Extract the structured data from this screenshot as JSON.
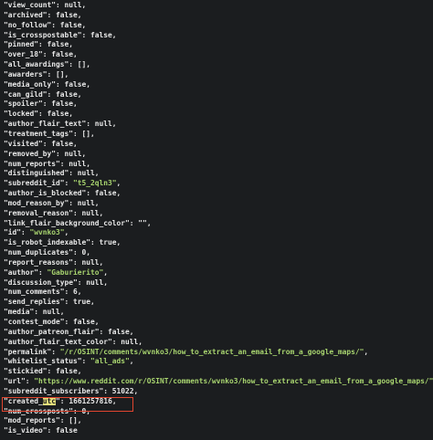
{
  "lines": [
    {
      "key": "\"view_count\"",
      "sep": ": ",
      "val": "null",
      "str": false,
      "end": ","
    },
    {
      "key": "\"archived\"",
      "sep": ": ",
      "val": "false",
      "str": false,
      "end": ","
    },
    {
      "key": "\"no_follow\"",
      "sep": ": ",
      "val": "false",
      "str": false,
      "end": ","
    },
    {
      "key": "\"is_crosspostable\"",
      "sep": ": ",
      "val": "false",
      "str": false,
      "end": ","
    },
    {
      "key": "\"pinned\"",
      "sep": ": ",
      "val": "false",
      "str": false,
      "end": ","
    },
    {
      "key": "\"over_18\"",
      "sep": ": ",
      "val": "false",
      "str": false,
      "end": ","
    },
    {
      "key": "\"all_awardings\"",
      "sep": ": ",
      "val": "[]",
      "str": false,
      "end": ","
    },
    {
      "key": "\"awarders\"",
      "sep": ": ",
      "val": "[]",
      "str": false,
      "end": ","
    },
    {
      "key": "\"media_only\"",
      "sep": ": ",
      "val": "false",
      "str": false,
      "end": ","
    },
    {
      "key": "\"can_gild\"",
      "sep": ": ",
      "val": "false",
      "str": false,
      "end": ","
    },
    {
      "key": "\"spoiler\"",
      "sep": ": ",
      "val": "false",
      "str": false,
      "end": ","
    },
    {
      "key": "\"locked\"",
      "sep": ": ",
      "val": "false",
      "str": false,
      "end": ","
    },
    {
      "key": "\"author_flair_text\"",
      "sep": ": ",
      "val": "null",
      "str": false,
      "end": ","
    },
    {
      "key": "\"treatment_tags\"",
      "sep": ": ",
      "val": "[]",
      "str": false,
      "end": ","
    },
    {
      "key": "\"visited\"",
      "sep": ": ",
      "val": "false",
      "str": false,
      "end": ","
    },
    {
      "key": "\"removed_by\"",
      "sep": ": ",
      "val": "null",
      "str": false,
      "end": ","
    },
    {
      "key": "\"num_reports\"",
      "sep": ": ",
      "val": "null",
      "str": false,
      "end": ","
    },
    {
      "key": "\"distinguished\"",
      "sep": ": ",
      "val": "null",
      "str": false,
      "end": ","
    },
    {
      "key": "\"subreddit_id\"",
      "sep": ": ",
      "val": "\"t5_2qln3\"",
      "str": true,
      "end": ","
    },
    {
      "key": "\"author_is_blocked\"",
      "sep": ": ",
      "val": "false",
      "str": false,
      "end": ","
    },
    {
      "key": "\"mod_reason_by\"",
      "sep": ": ",
      "val": "null",
      "str": false,
      "end": ","
    },
    {
      "key": "\"removal_reason\"",
      "sep": ": ",
      "val": "null",
      "str": false,
      "end": ","
    },
    {
      "key": "\"link_flair_background_color\"",
      "sep": ": ",
      "val": "\"\"",
      "str": false,
      "end": ","
    },
    {
      "key": "\"id\"",
      "sep": ": ",
      "val": "\"wvnko3\"",
      "str": true,
      "end": ","
    },
    {
      "key": "\"is_robot_indexable\"",
      "sep": ": ",
      "val": "true",
      "str": false,
      "end": ","
    },
    {
      "key": "\"num_duplicates\"",
      "sep": ": ",
      "val": "0",
      "str": false,
      "end": ","
    },
    {
      "key": "\"report_reasons\"",
      "sep": ": ",
      "val": "null",
      "str": false,
      "end": ","
    },
    {
      "key": "\"author\"",
      "sep": ": ",
      "val": "\"Gaburierito\"",
      "str": true,
      "end": ","
    },
    {
      "key": "\"discussion_type\"",
      "sep": ": ",
      "val": "null",
      "str": false,
      "end": ","
    },
    {
      "key": "\"num_comments\"",
      "sep": ": ",
      "val": "6",
      "str": false,
      "end": ","
    },
    {
      "key": "\"send_replies\"",
      "sep": ": ",
      "val": "true",
      "str": false,
      "end": ","
    },
    {
      "key": "\"media\"",
      "sep": ": ",
      "val": "null",
      "str": false,
      "end": ","
    },
    {
      "key": "\"contest_mode\"",
      "sep": ": ",
      "val": "false",
      "str": false,
      "end": ","
    },
    {
      "key": "\"author_patreon_flair\"",
      "sep": ": ",
      "val": "false",
      "str": false,
      "end": ","
    },
    {
      "key": "\"author_flair_text_color\"",
      "sep": ": ",
      "val": "null",
      "str": false,
      "end": ","
    },
    {
      "key": "\"permalink\"",
      "sep": ": ",
      "val": "\"/r/OSINT/comments/wvnko3/how_to_extract_an_email_from_a_google_maps/\"",
      "str": true,
      "end": ","
    },
    {
      "key": "\"whitelist_status\"",
      "sep": ": ",
      "val": "\"all_ads\"",
      "str": true,
      "end": ","
    },
    {
      "key": "\"stickied\"",
      "sep": ": ",
      "val": "false",
      "str": false,
      "end": ","
    },
    {
      "key": "\"url\"",
      "sep": ": ",
      "val": "\"https://www.reddit.com/r/OSINT/comments/wvnko3/how_to_extract_an_email_from_a_google_maps/\"",
      "str": true,
      "end": ","
    },
    {
      "key": "\"subreddit_subscribers\"",
      "sep": ": ",
      "val": "51022",
      "str": false,
      "end": ","
    },
    {
      "key": "\"created_utc\"",
      "sep": ": ",
      "val": "1661257816",
      "str": false,
      "end": ",",
      "highlight": "utc"
    },
    {
      "key": "\"num_crossposts\"",
      "sep": ": ",
      "val": "0",
      "str": false,
      "end": ","
    },
    {
      "key": "\"mod_reports\"",
      "sep": ": ",
      "val": "[]",
      "str": false,
      "end": ","
    },
    {
      "key": "\"is_video\"",
      "sep": ": ",
      "val": "false",
      "str": false,
      "end": ""
    }
  ],
  "colors": {
    "background": "#1b1d1f",
    "text": "#e8e8e8",
    "string": "#a8d46f",
    "highlight_bg": "#e6e07a",
    "box_border": "#e0452f"
  }
}
